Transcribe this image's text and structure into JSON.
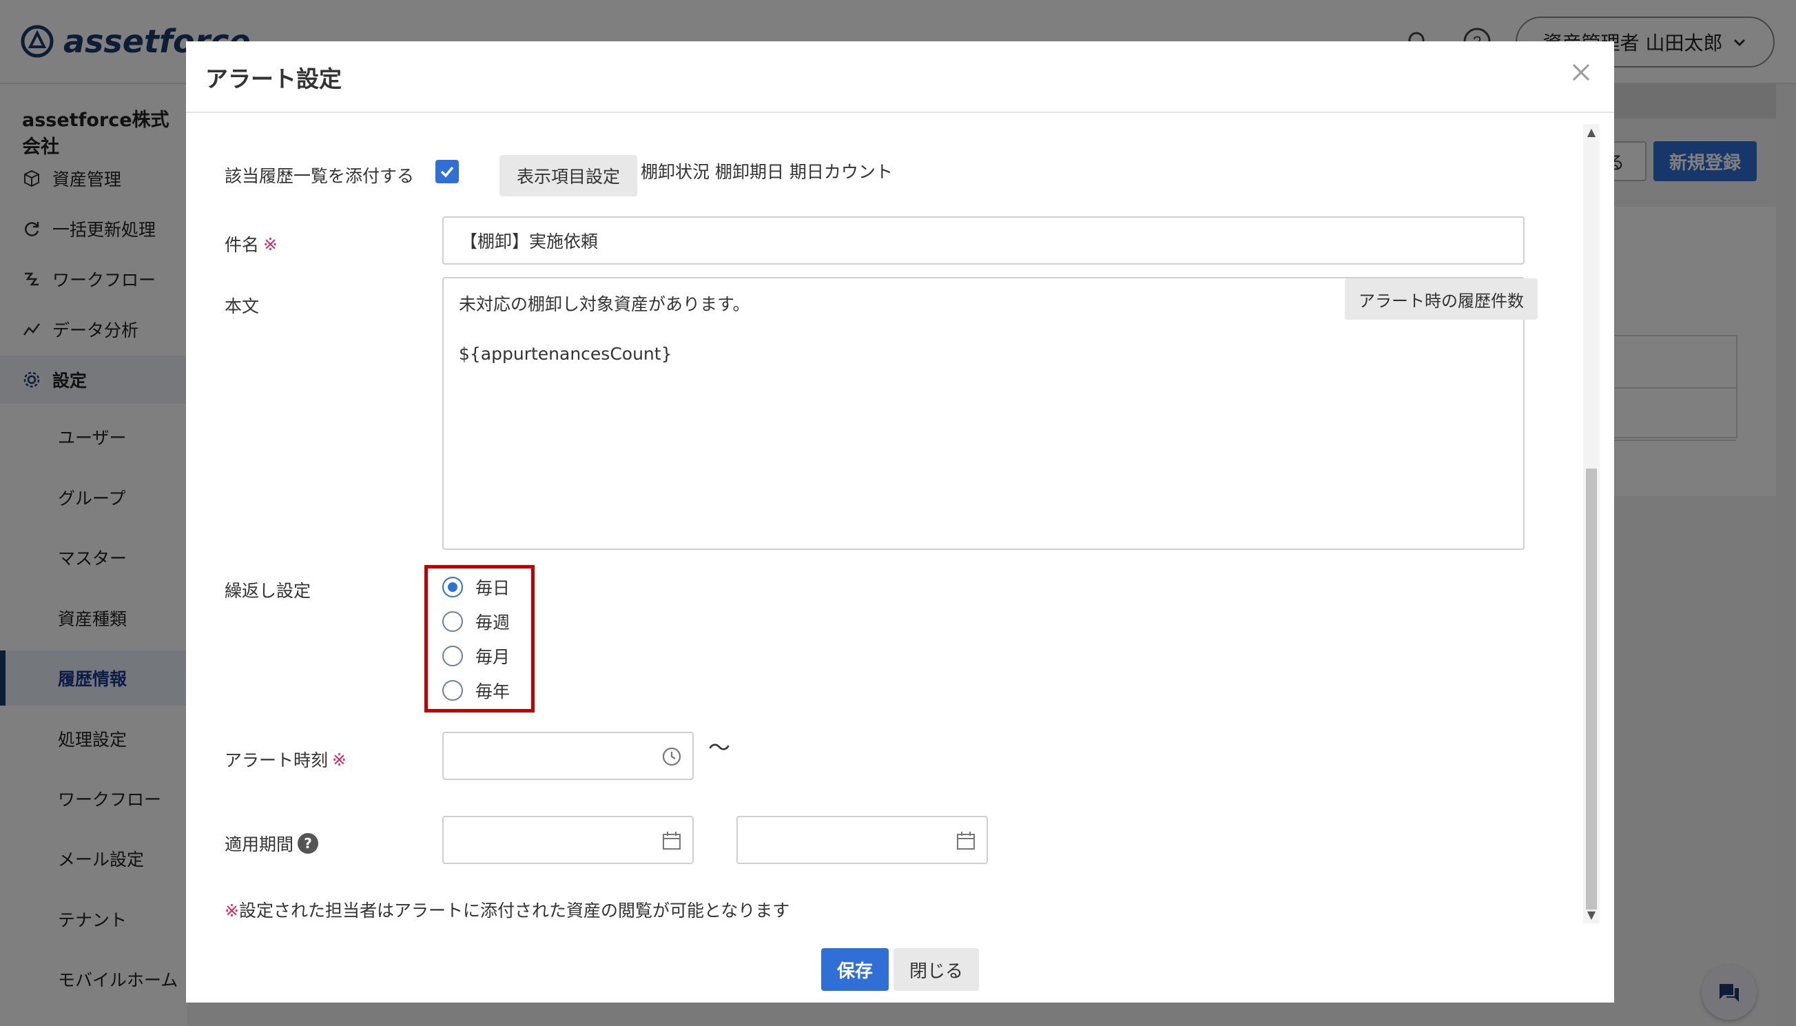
{
  "app": {
    "logo_text": "assetforce",
    "user_name": "資産管理者 山田太郎",
    "company": "assetforce株式会社",
    "sidebar": {
      "items": [
        {
          "label": "資産管理",
          "icon": "box-icon"
        },
        {
          "label": "一括更新処理",
          "icon": "refresh-icon"
        },
        {
          "label": "ワークフロー",
          "icon": "workflow-icon"
        },
        {
          "label": "データ分析",
          "icon": "chart-icon"
        },
        {
          "label": "設定",
          "icon": "gear-icon"
        }
      ],
      "subitems": [
        {
          "label": "ユーザー"
        },
        {
          "label": "グループ"
        },
        {
          "label": "マスター"
        },
        {
          "label": "資産種類"
        },
        {
          "label": "履歴情報"
        },
        {
          "label": "処理設定"
        },
        {
          "label": "ワークフロー"
        },
        {
          "label": "メール設定"
        },
        {
          "label": "テナント"
        },
        {
          "label": "モバイルホーム"
        }
      ]
    },
    "toolbar": {
      "back_label": "る",
      "new_label": "新規登録"
    }
  },
  "modal": {
    "title": "アラート設定",
    "attach_label": "該当履歴一覧を添付する",
    "attach_checked": true,
    "display_items_button": "表示項目設定",
    "display_items_text": "棚卸状況 棚卸期日 期日カウント",
    "subject_label": "件名",
    "required_mark": "※",
    "subject_value": "【棚卸】実施依頼",
    "body_label": "本文",
    "body_value": "未対応の棚卸し対象資産があります。\n\n${appurtenancesCount}",
    "history_count_button": "アラート時の履歴件数",
    "repeat_label": "繰返し設定",
    "repeat_options": [
      {
        "label": "毎日",
        "checked": true
      },
      {
        "label": "毎週",
        "checked": false
      },
      {
        "label": "毎月",
        "checked": false
      },
      {
        "label": "毎年",
        "checked": false
      }
    ],
    "alert_time_label": "アラート時刻",
    "alert_time_value": "",
    "period_label": "適用期間",
    "period_separator": "〜",
    "period_start_value": "",
    "period_end_value": "",
    "note_mark": "※",
    "note_text": "設定された担当者はアラートに添付された資産の閲覧が可能となります",
    "save_label": "保存",
    "close_label": "閉じる"
  },
  "colors": {
    "primary": "#2f6fd6",
    "required": "#e0245e",
    "highlight_box": "#c00000",
    "brand": "#1b3a6b"
  }
}
